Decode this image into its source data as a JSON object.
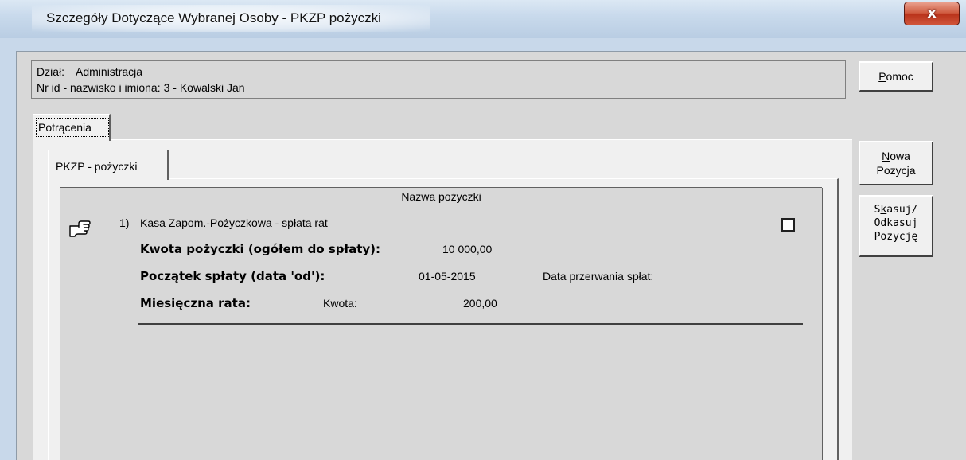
{
  "window": {
    "title": "Szczegóły Dotyczące Wybranej Osoby - PKZP pożyczki",
    "close_label": "x"
  },
  "info": {
    "dept_label": "Dział:",
    "dept_value": "Administracja",
    "person_label": "Nr id - nazwisko i imiona:",
    "person_value": "3 - Kowalski Jan"
  },
  "buttons": {
    "help_label": "Pomoc",
    "help_mnemonic": "P",
    "new_line1": "Nowa",
    "new_line2": "Pozycja",
    "new_mnemonic": "N",
    "delete_line1": "Skasuj/",
    "delete_line2": "Odkasuj",
    "delete_line3": "Pozycję",
    "delete_mnemonic": "k"
  },
  "tabs": {
    "outer": "Potrącenia",
    "inner": "PKZP - pożyczki"
  },
  "grid": {
    "header": "Nazwa pożyczki",
    "rows": [
      {
        "number": "1)",
        "name": "Kasa Zapom.-Pożyczkowa - spłata rat",
        "checked": false,
        "amount_label": "Kwota pożyczki (ogółem do spłaty):",
        "amount_value": "10 000,00",
        "start_label": "Początek spłaty (data 'od'):",
        "start_value": "01-05-2015",
        "stop_label": "Data przerwania spłat:",
        "stop_value": "",
        "installment_label": "Miesięczna rata:",
        "installment_amount_label": "Kwota:",
        "installment_value": "200,00"
      }
    ]
  },
  "icons": {
    "pointer": "pointing-hand-icon",
    "close": "close-icon"
  },
  "colors": {
    "close_button": "#c8462c",
    "titlebar": "#c9daec",
    "dialog_face": "#d8d8d8"
  }
}
